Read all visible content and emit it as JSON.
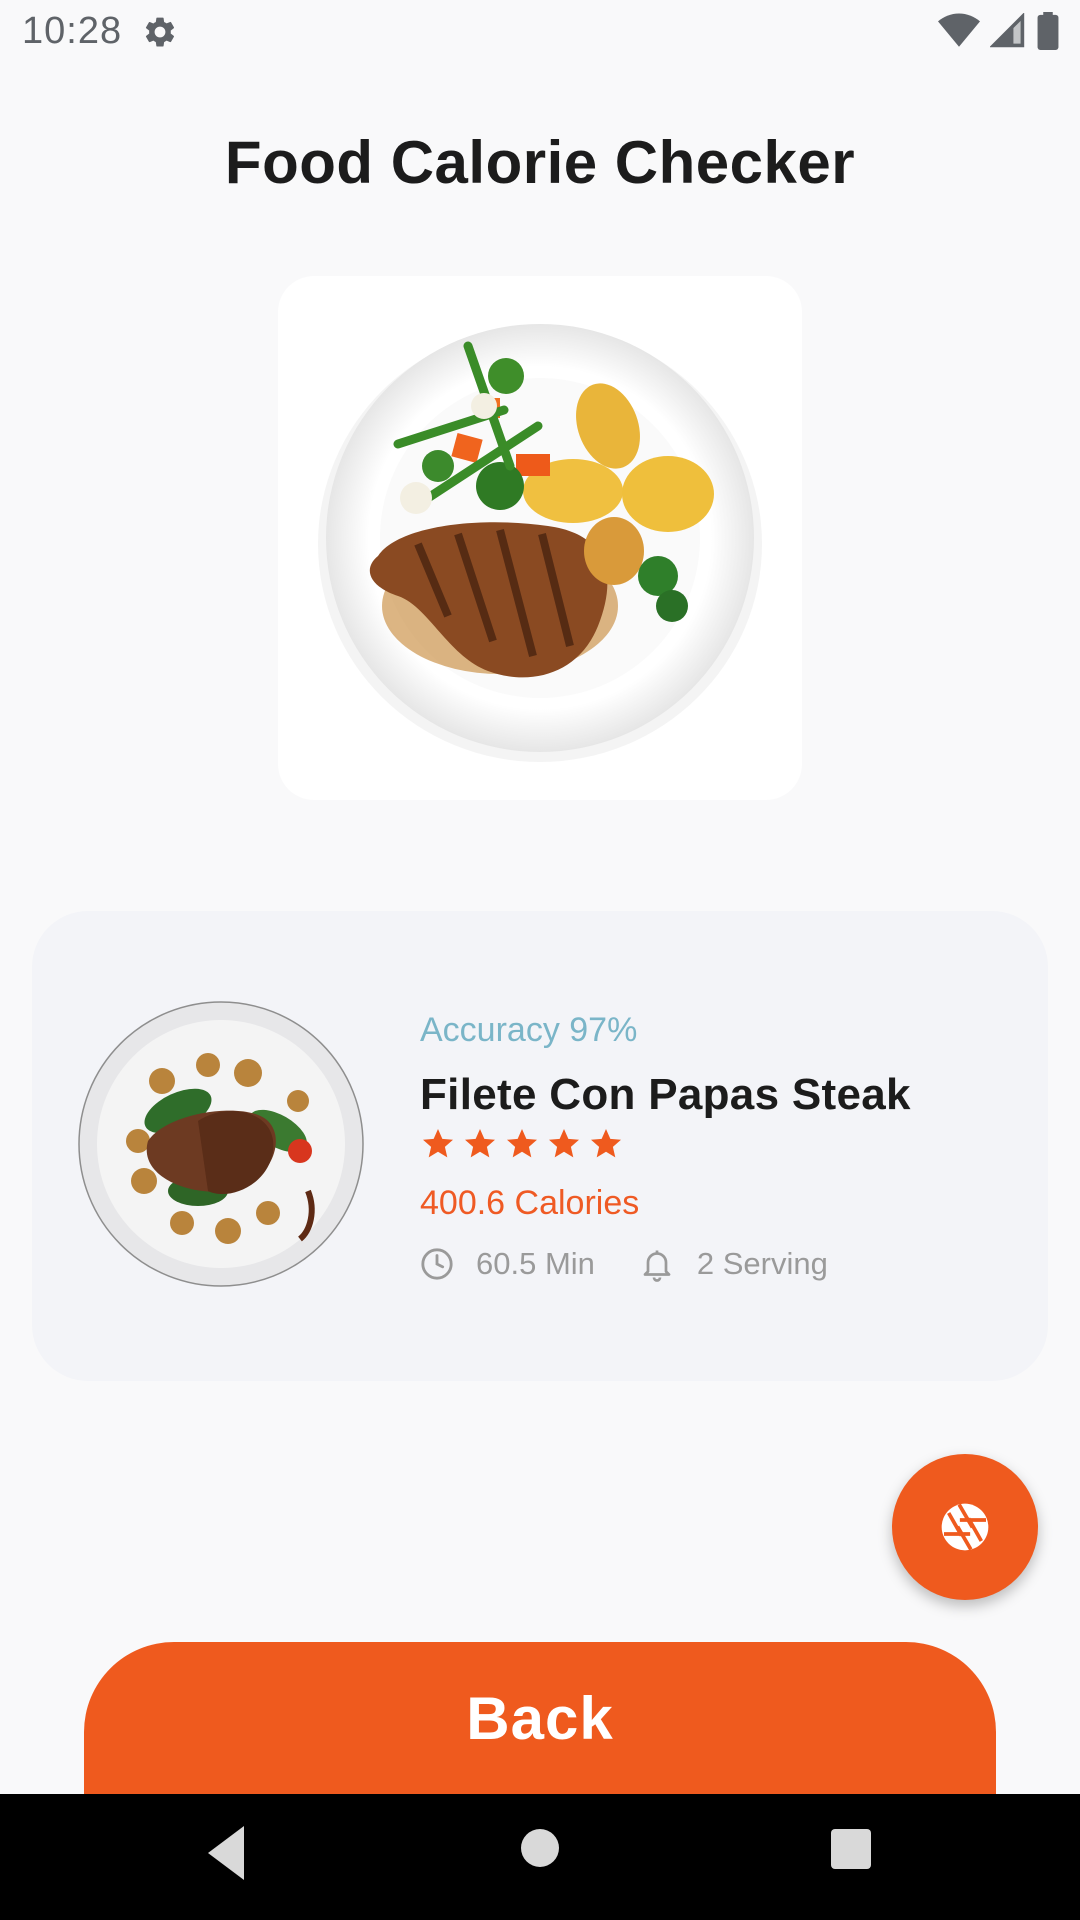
{
  "status_bar": {
    "time": "10:28",
    "icons": [
      "gear-icon",
      "wifi-icon",
      "signal-icon",
      "battery-icon"
    ]
  },
  "page": {
    "title": "Food Calorie Checker"
  },
  "result": {
    "accuracy": "Accuracy 97%",
    "food_name": "Filete Con Papas Steak",
    "rating": 5,
    "calories": "400.6 Calories",
    "time": "60.5 Min",
    "servings": "2 Serving"
  },
  "actions": {
    "back_label": "Back",
    "fab_icon": "camera-shutter-icon"
  },
  "nav_bar": {
    "icons": [
      "back-triangle-icon",
      "home-circle-icon",
      "recents-square-icon"
    ]
  },
  "colors": {
    "accent": "#ef5a1e",
    "accuracy_text": "#7ab5c8",
    "card_bg": "#f3f4f8",
    "background": "#f9f9fa"
  }
}
